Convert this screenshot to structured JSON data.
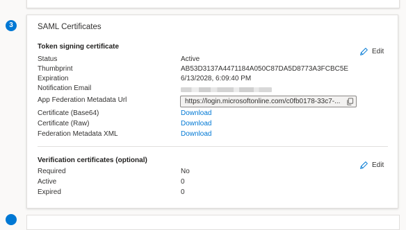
{
  "step_badges": {
    "current": "3"
  },
  "saml": {
    "title": "SAML Certificates",
    "token": {
      "heading": "Token signing certificate",
      "edit_label": "Edit",
      "status_label": "Status",
      "status_value": "Active",
      "thumbprint_label": "Thumbprint",
      "thumbprint_value": "AB53D3137A4471184A050C87DA5D8773A3FCBC5E",
      "expiration_label": "Expiration",
      "expiration_value": "6/13/2028, 6:09:40 PM",
      "notification_label": "Notification Email",
      "federation_url_label": "App Federation Metadata Url",
      "federation_url_value": "https://login.microsoftonline.com/c0fb0178-33c7-...",
      "cert_base64_label": "Certificate (Base64)",
      "cert_raw_label": "Certificate (Raw)",
      "federation_xml_label": "Federation Metadata XML",
      "download_label": "Download"
    },
    "verification": {
      "heading": "Verification certificates (optional)",
      "edit_label": "Edit",
      "required_label": "Required",
      "required_value": "No",
      "active_label": "Active",
      "active_value": "0",
      "expired_label": "Expired",
      "expired_value": "0"
    }
  },
  "icons": {
    "edit": "pencil-icon",
    "copy": "copy-icon"
  },
  "colors": {
    "accent": "#0078d4",
    "text": "#323130",
    "border": "#e1dfdd"
  }
}
